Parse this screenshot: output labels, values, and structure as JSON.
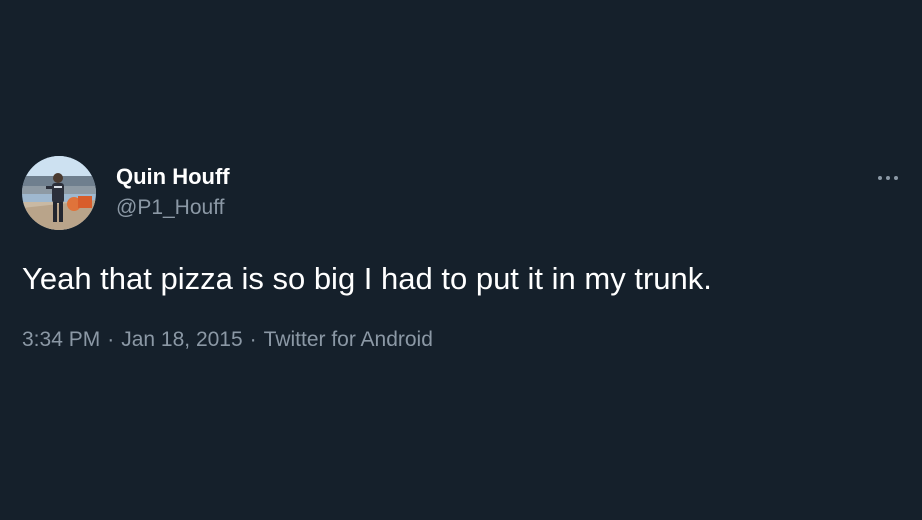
{
  "tweet": {
    "author": {
      "display_name": "Quin Houff",
      "handle": "@P1_Houff"
    },
    "text": "Yeah that pizza is so big I had to put it in my trunk.",
    "time": "3:34 PM",
    "separator": "·",
    "date": "Jan 18, 2015",
    "source": "Twitter for Android",
    "more_icon": "more-horizontal-icon"
  },
  "colors": {
    "background": "#15202b",
    "primary_text": "#ffffff",
    "secondary_text": "#8b98a5"
  }
}
